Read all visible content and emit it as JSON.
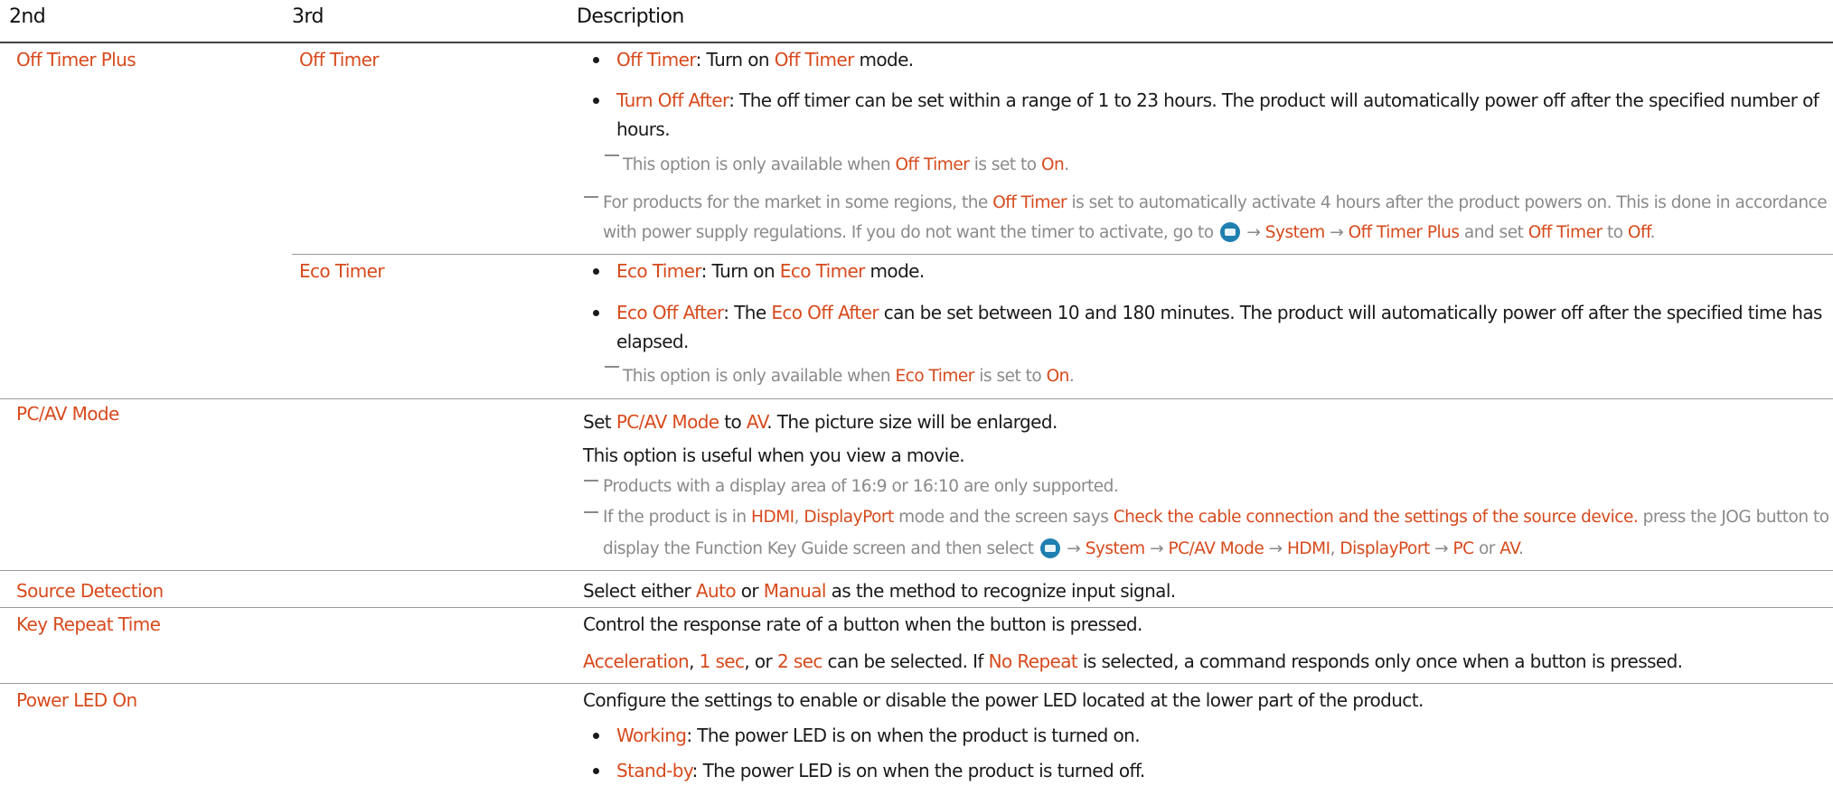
{
  "header": {
    "col1": "2nd",
    "col2": "3rd",
    "col3": "Description"
  },
  "arrow": "→",
  "sections": {
    "off_timer_plus": {
      "label": "Off Timer Plus",
      "off_timer": {
        "label": "Off Timer",
        "b1_term": "Off Timer",
        "b1_a": ": Turn on ",
        "b1_term2": "Off Timer",
        "b1_b": " mode.",
        "b2_term": "Turn Off After",
        "b2_line1": ": The off timer can be set within a range of 1 to 23 hours. The product will automatically power off after the specified number of",
        "b2_line2": "hours.",
        "note1_a": "This option is only available when ",
        "note1_term": "Off Timer",
        "note1_b": " is set to ",
        "note1_term2": "On",
        "note1_c": ".",
        "note2_a": "For products for the market in some regions, the ",
        "note2_term": "Off Timer",
        "note2_b": " is set to automatically activate 4 hours after the product powers on. This is done in accordance",
        "note2_c": "with power supply regulations. If you do not want the timer to activate, go to ",
        "note2_sys": "System",
        "note2_otp": "Off Timer Plus",
        "note2_d": " and set ",
        "note2_ot": "Off Timer",
        "note2_e": " to ",
        "note2_off": "Off",
        "note2_f": "."
      },
      "eco_timer": {
        "label": "Eco Timer",
        "b1_term": "Eco Timer",
        "b1_a": ": Turn on ",
        "b1_term2": "Eco Timer",
        "b1_b": " mode.",
        "b2_term": "Eco Off After",
        "b2_a": ": The ",
        "b2_term2": "Eco Off After",
        "b2_b": " can be set between 10 and 180 minutes. The product will automatically power off after the specified time has",
        "b2_line2": "elapsed.",
        "note_a": "This option is only available when ",
        "note_term": "Eco Timer",
        "note_b": " is set to ",
        "note_term2": "On",
        "note_c": "."
      }
    },
    "pc_av_mode": {
      "label": "PC/AV Mode",
      "l1_a": "Set ",
      "l1_term": "PC/AV Mode",
      "l1_b": " to ",
      "l1_term2": "AV",
      "l1_c": ". The picture size will be enlarged.",
      "l2": "This option is useful when you view a movie.",
      "note1": "Products with a display area of 16:9 or 16:10 are only supported.",
      "note2_a": "If the product is in ",
      "note2_hdmi": "HDMI",
      "note2_comma": ", ",
      "note2_dp": "DisplayPort",
      "note2_b": " mode and the screen says ",
      "note2_msg": "Check the cable connection and the settings of the source device.",
      "note2_c": " press the JOG button to",
      "note2_d": "display the Function Key Guide screen and then select ",
      "note2_sys": "System",
      "note2_pcav": "PC/AV Mode",
      "note2_hdmi2": "HDMI",
      "note2_comma2": ", ",
      "note2_dp2": "DisplayPort",
      "note2_pc": "PC",
      "note2_or": " or ",
      "note2_av": "AV",
      "note2_end": "."
    },
    "source_detection": {
      "label": "Source Detection",
      "a": "Select either ",
      "auto": "Auto",
      "b": " or ",
      "manual": "Manual",
      "c": " as the method to recognize input signal."
    },
    "key_repeat_time": {
      "label": "Key Repeat Time",
      "l1": "Control the response rate of a button when the button is pressed.",
      "accel": "Acceleration",
      "comma": ", ",
      "one_sec": "1 sec",
      "or": ", or ",
      "two_sec": "2 sec",
      "mid": " can be selected. If ",
      "no_repeat": "No Repeat",
      "end": " is selected, a command responds only once when a button is pressed."
    },
    "power_led_on": {
      "label": "Power LED On",
      "l1": "Configure the settings to enable or disable the power LED located at the lower part of the product.",
      "b1_term": "Working",
      "b1": ": The power LED is on when the product is turned on.",
      "b2_term": "Stand-by",
      "b2": ": The power LED is on when the product is turned off."
    }
  },
  "colors": {
    "accent": "#d74a1c",
    "note": "#8a8a8a",
    "icon": "#1f7fb0"
  },
  "icons": [
    "menu-icon",
    "bullet",
    "note-dash"
  ]
}
